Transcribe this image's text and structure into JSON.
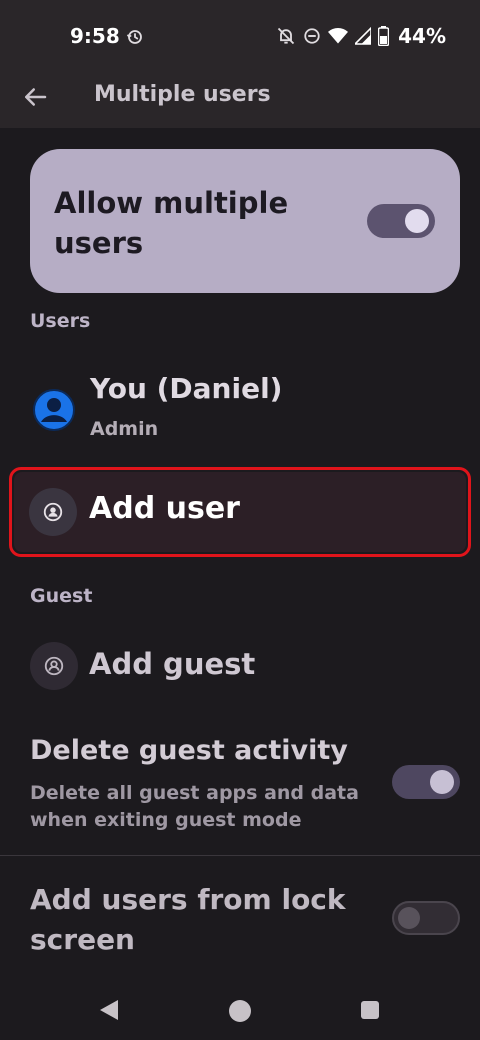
{
  "status_bar": {
    "time": "9:58",
    "battery": "44%",
    "icons": [
      "alarm-icon",
      "mute-icon",
      "dnd-icon",
      "wifi-icon",
      "signal-icon",
      "battery-icon"
    ]
  },
  "app_bar": {
    "title": "Multiple users",
    "back_icon": "back-arrow-icon"
  },
  "allow_card": {
    "title": "Allow multiple users",
    "toggle_on": true
  },
  "sections": {
    "users_label": "Users",
    "guest_label": "Guest"
  },
  "users": [
    {
      "name": "You (Daniel)",
      "role": "Admin",
      "icon": "account-circle-icon"
    }
  ],
  "add_user": {
    "label": "Add user",
    "icon": "person-add-icon",
    "highlighted": true
  },
  "add_guest": {
    "label": "Add guest",
    "icon": "person-icon"
  },
  "delete_guest_activity": {
    "title": "Delete guest activity",
    "subtitle": "Delete all guest apps and data when exiting guest mode",
    "toggle_on": true
  },
  "lock_screen": {
    "title": "Add users from lock screen",
    "toggle_on": false
  },
  "colors": {
    "background": "#1c1a1e",
    "card": "#b6adc5",
    "highlight": "#e0141b",
    "avatar_blue": "#1a73e8"
  }
}
